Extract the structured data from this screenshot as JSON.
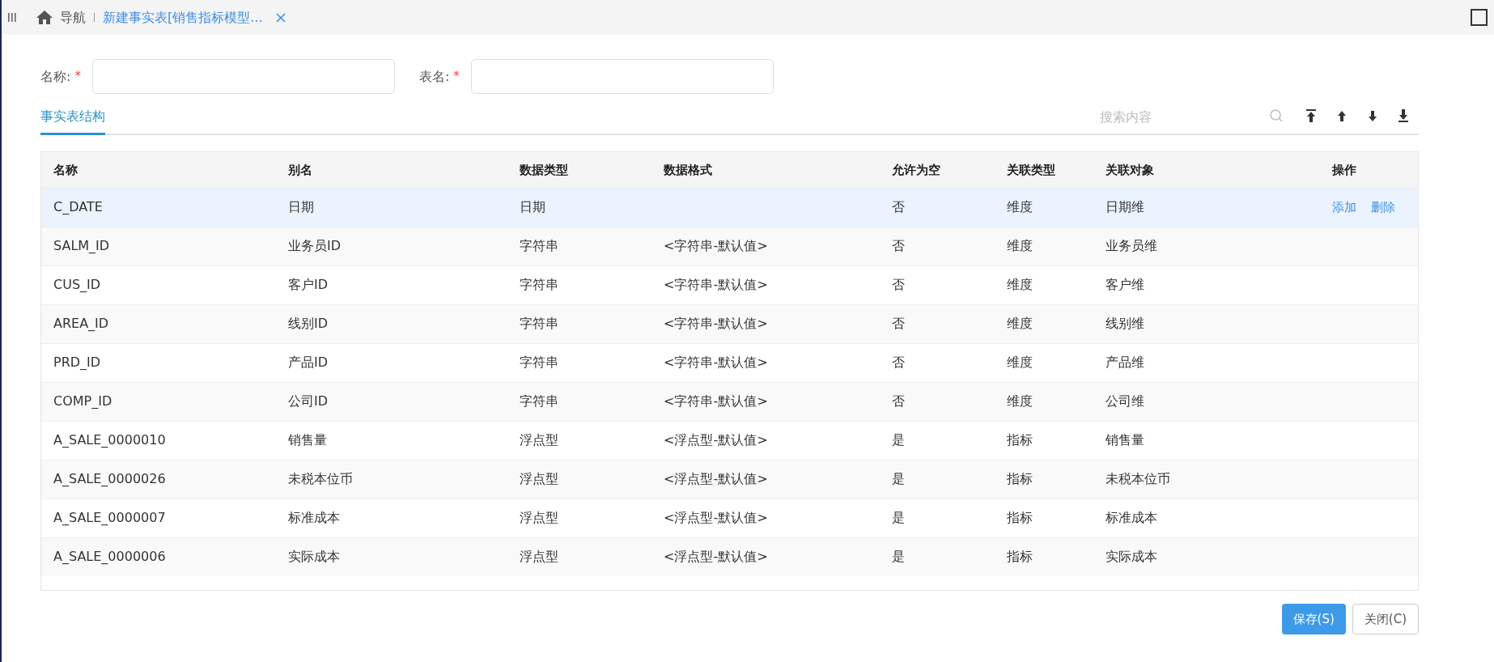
{
  "tabs": [
    {
      "kind": "home",
      "label": "导航",
      "selected": false
    },
    {
      "kind": "doc",
      "label": "新建事实表[销售指标模型...",
      "selected": true
    }
  ],
  "form": [
    {
      "label": "名称:",
      "required_mark": "*"
    },
    {
      "label": "表名:",
      "required_mark": "*"
    }
  ],
  "section_tab": {
    "label": "事实表结构",
    "selected": true
  },
  "search": {
    "placeholder": "搜索内容"
  },
  "table": {
    "columns": [
      "名称",
      "别名",
      "数据类型",
      "数据格式",
      "允许为空",
      "关联类型",
      "关联对象",
      "操作"
    ],
    "rows": [
      {
        "selected": true,
        "cells": [
          "C_DATE",
          "日期",
          "日期",
          "",
          "否",
          "维度",
          "日期维"
        ],
        "actions": [
          "添加",
          "删除"
        ]
      },
      {
        "selected": false,
        "cells": [
          "SALM_ID",
          "业务员ID",
          "字符串",
          "<字符串-默认值>",
          "否",
          "维度",
          "业务员维"
        ]
      },
      {
        "selected": false,
        "cells": [
          "CUS_ID",
          "客户ID",
          "字符串",
          "<字符串-默认值>",
          "否",
          "维度",
          "客户维"
        ]
      },
      {
        "selected": false,
        "cells": [
          "AREA_ID",
          "线别ID",
          "字符串",
          "<字符串-默认值>",
          "否",
          "维度",
          "线别维"
        ]
      },
      {
        "selected": false,
        "cells": [
          "PRD_ID",
          "产品ID",
          "字符串",
          "<字符串-默认值>",
          "否",
          "维度",
          "产品维"
        ]
      },
      {
        "selected": false,
        "cells": [
          "COMP_ID",
          "公司ID",
          "字符串",
          "<字符串-默认值>",
          "否",
          "维度",
          "公司维"
        ]
      },
      {
        "selected": false,
        "cells": [
          "A_SALE_0000010",
          "销售量",
          "浮点型",
          "<浮点型-默认值>",
          "是",
          "指标",
          "销售量"
        ]
      },
      {
        "selected": false,
        "cells": [
          "A_SALE_0000026",
          "未税本位币",
          "浮点型",
          "<浮点型-默认值>",
          "是",
          "指标",
          "未税本位币"
        ]
      },
      {
        "selected": false,
        "cells": [
          "A_SALE_0000007",
          "标准成本",
          "浮点型",
          "<浮点型-默认值>",
          "是",
          "指标",
          "标准成本"
        ]
      },
      {
        "selected": false,
        "cells": [
          "A_SALE_0000006",
          "实际成本",
          "浮点型",
          "<浮点型-默认值>",
          "是",
          "指标",
          "实际成本"
        ]
      }
    ]
  },
  "buttons": [
    {
      "kind": "primary",
      "label": "保存(S)"
    },
    {
      "kind": "secondary",
      "label": "关闭(C)"
    }
  ]
}
